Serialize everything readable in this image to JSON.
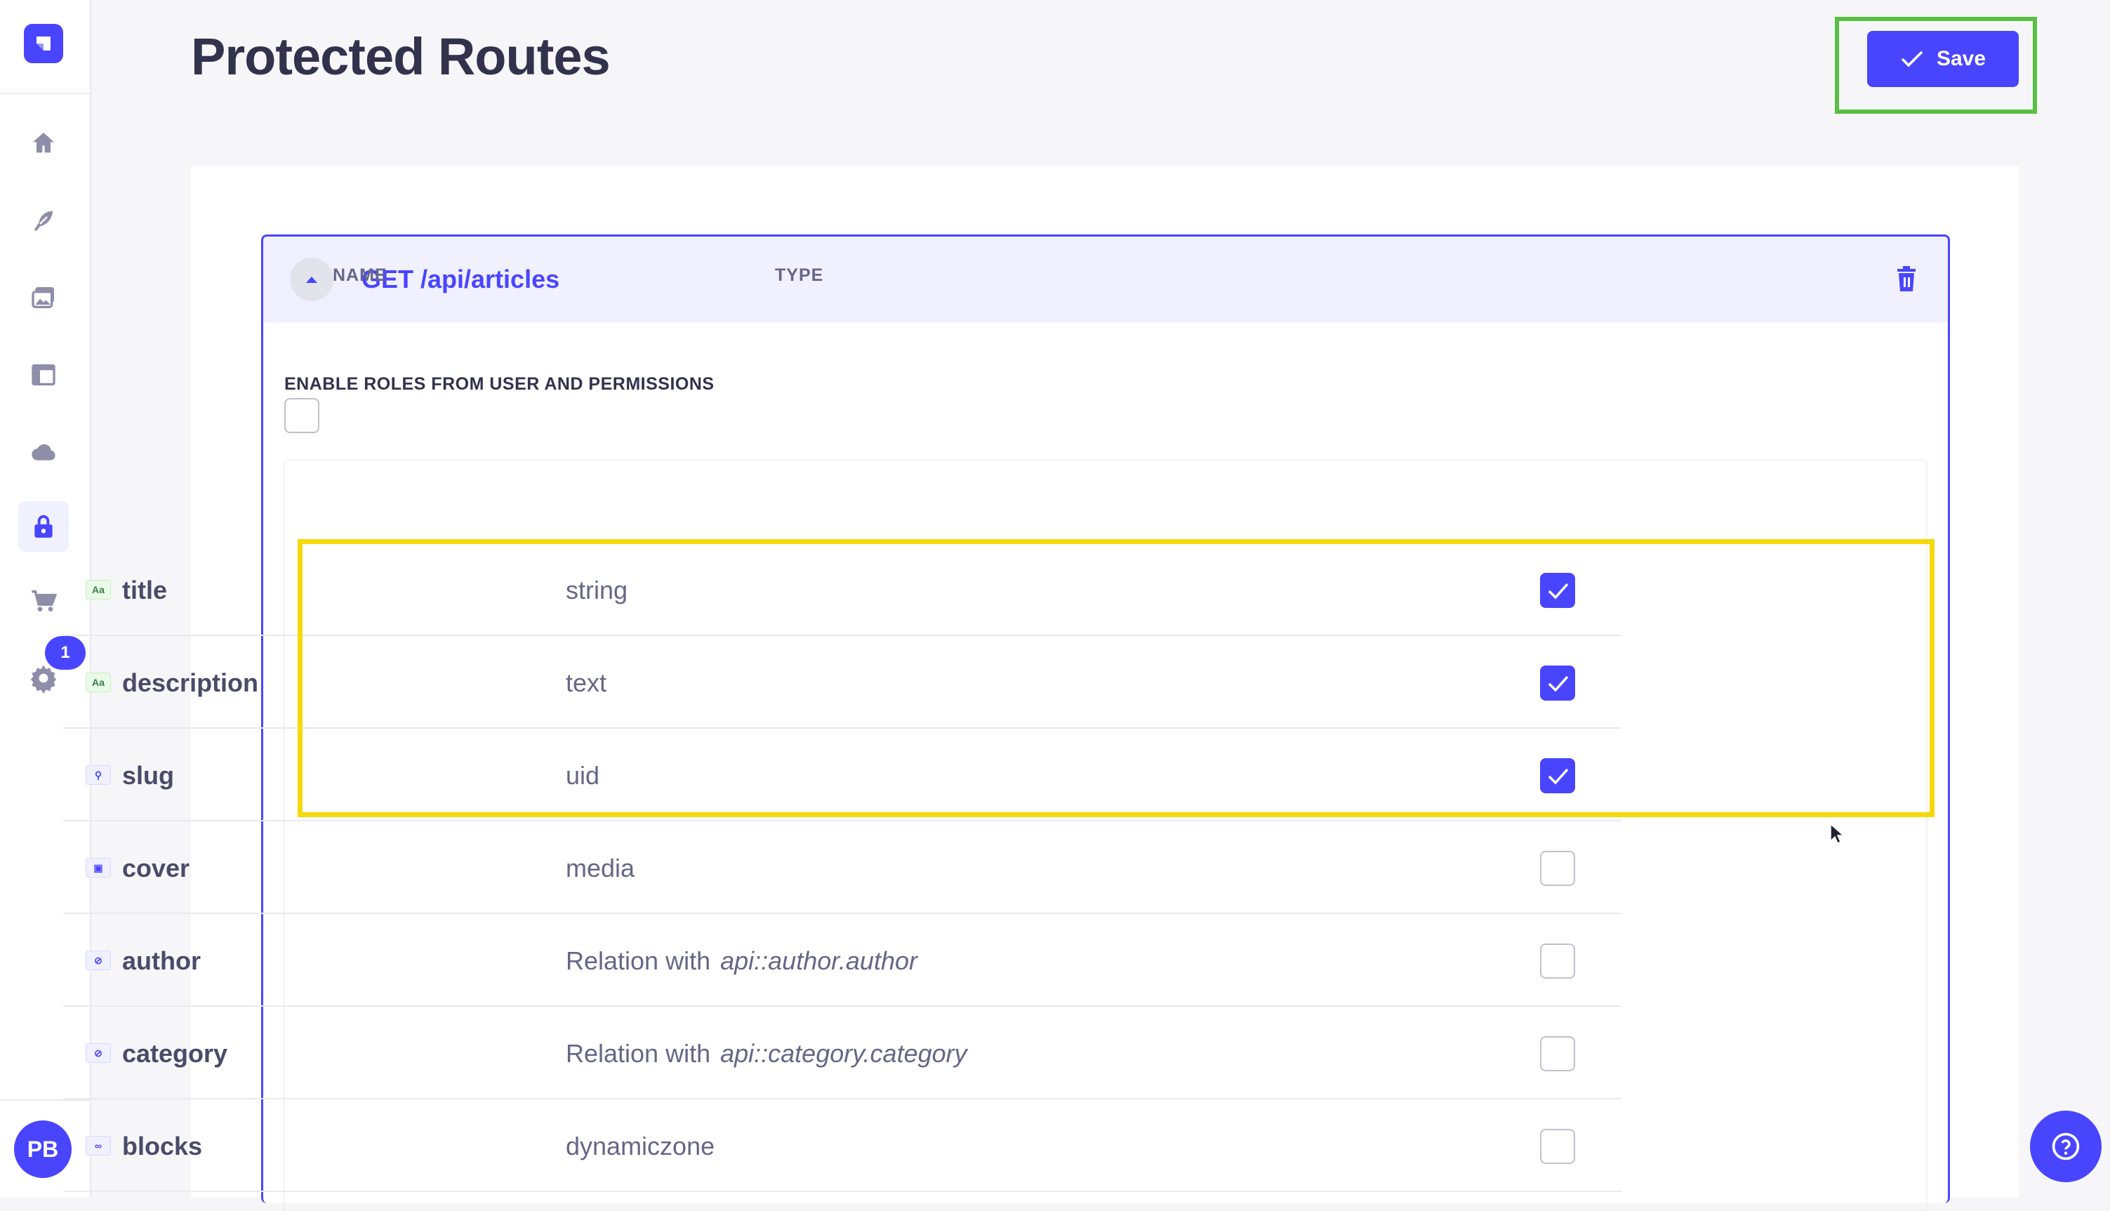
{
  "page": {
    "title": "Protected Routes",
    "save_label": "Save"
  },
  "sidebar": {
    "items": [
      {
        "icon": "home-icon"
      },
      {
        "icon": "feather-icon"
      },
      {
        "icon": "media-library-icon"
      },
      {
        "icon": "layout-icon"
      },
      {
        "icon": "cloud-icon"
      },
      {
        "icon": "lock-icon",
        "active": true
      },
      {
        "icon": "cart-icon"
      },
      {
        "icon": "gear-icon"
      }
    ],
    "settings_badge": "1",
    "avatar_initials": "PB"
  },
  "route": {
    "title": "GET /api/articles",
    "enable_roles_label": "ENABLE ROLES FROM USER AND PERMISSIONS",
    "enable_roles_checked": false,
    "columns": {
      "name": "NAME",
      "type": "TYPE"
    },
    "fields": [
      {
        "name": "title",
        "type": "string",
        "type_target": "",
        "icon": "text-icon",
        "icon_glyph": "Aa",
        "checked": true
      },
      {
        "name": "description",
        "type": "text",
        "type_target": "",
        "icon": "text-icon",
        "icon_glyph": "Aa",
        "checked": true
      },
      {
        "name": "slug",
        "type": "uid",
        "type_target": "",
        "icon": "key-icon",
        "icon_glyph": "⚲",
        "checked": true
      },
      {
        "name": "cover",
        "type": "media",
        "type_target": "",
        "icon": "image-icon",
        "icon_glyph": "▣",
        "checked": false
      },
      {
        "name": "author",
        "type": "Relation with",
        "type_target": "api::author.author",
        "icon": "link-icon",
        "icon_glyph": "⊘",
        "checked": false
      },
      {
        "name": "category",
        "type": "Relation with",
        "type_target": "api::category.category",
        "icon": "link-icon",
        "icon_glyph": "⊘",
        "checked": false
      },
      {
        "name": "blocks",
        "type": "dynamiczone",
        "type_target": "",
        "icon": "infinity-icon",
        "icon_glyph": "∞",
        "checked": false
      }
    ]
  },
  "colors": {
    "primary": "#4945ff",
    "save_highlight": "#57c041",
    "rows_highlight": "#f5d90a"
  }
}
